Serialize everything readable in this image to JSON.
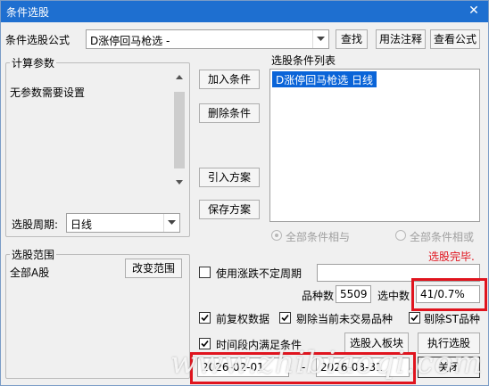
{
  "window": {
    "title": "条件选股"
  },
  "formula": {
    "label": "条件选股公式",
    "value": "D涨停回马枪选  -",
    "find_btn": "查找",
    "usage_btn": "用法注释",
    "view_btn": "查看公式"
  },
  "params": {
    "group_label": "计算参数",
    "text": "无参数需要设置",
    "period_label": "选股周期:",
    "period_value": "日线"
  },
  "actions": {
    "add": "加入条件",
    "delete": "删除条件",
    "import": "引入方案",
    "save": "保存方案"
  },
  "condition_list": {
    "label": "选股条件列表",
    "items": [
      "D涨停回马枪选  日线"
    ]
  },
  "logic": {
    "all_and": "全部条件相与",
    "all_or": "全部条件相或"
  },
  "status": {
    "text": "选股完毕.",
    "color": "#e0141e"
  },
  "range": {
    "group_label": "选股范围",
    "value": "全部A股",
    "change_btn": "改变范围"
  },
  "options": {
    "use_irregular": "使用涨跌不定周期",
    "count_label": "品种数",
    "count_value": "5509",
    "selected_label": "选中数",
    "selected_value": "41/0.7%",
    "pre_adjust": "前复权数据",
    "exclude_untraded": "剔除当前未交易品种",
    "exclude_st": "剔除ST品种",
    "time_range": "时间段内满足条件"
  },
  "dates": {
    "start": "2026-02-01",
    "separator": "-",
    "end": "2026-03-31"
  },
  "buttons": {
    "to_block": "选股入板块",
    "execute": "执行选股",
    "close": "关闭"
  },
  "watermark": "www.zhibiaoqi.com",
  "colors": {
    "titlebar": "#1e6fd0",
    "highlight_box": "#e0141e",
    "selection": "#0a64d8"
  }
}
